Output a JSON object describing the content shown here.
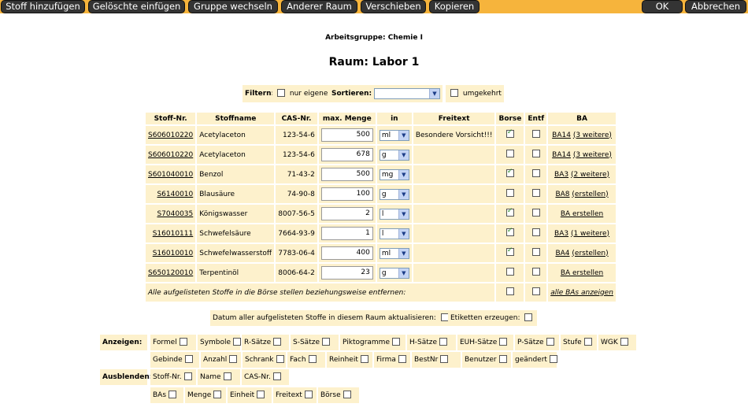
{
  "toolbar": {
    "left_buttons": [
      "Stoff hinzufügen",
      "Gelöschte einfügen",
      "Gruppe wechseln",
      "Anderer Raum",
      "Verschieben",
      "Kopieren"
    ],
    "right_buttons": [
      "OK",
      "Abbrechen"
    ],
    "bar_color": "#f6b43c"
  },
  "header": {
    "arbeitsgruppe": "Arbeitsgruppe: Chemie I",
    "raum": "Raum: Labor 1"
  },
  "filter": {
    "filter_label": "Filtern:",
    "nur_eigene": "nur eigene",
    "sortieren_label": "Sortieren:",
    "sortieren_value": "",
    "umgekehrt": "umgekehrt"
  },
  "table": {
    "columns": [
      "Stoff-Nr.",
      "Stoffname",
      "CAS-Nr.",
      "max. Menge",
      "in",
      "Freitext",
      "Borse",
      "Entf",
      "BA"
    ],
    "rows": [
      {
        "nr": "S606010220",
        "name": "Acetylaceton",
        "cas": "123-54-6",
        "menge": "500",
        "unit": "ml",
        "freitext": "Besondere Vorsicht!!!",
        "borse": true,
        "entf": false,
        "ba": "BA14",
        "ba_more": "(3 weitere)"
      },
      {
        "nr": "S606010220",
        "name": "Acetylaceton",
        "cas": "123-54-6",
        "menge": "678",
        "unit": "g",
        "freitext": "",
        "borse": false,
        "entf": false,
        "ba": "BA14",
        "ba_more": "(3 weitere)"
      },
      {
        "nr": "S601040010",
        "name": "Benzol",
        "cas": "71-43-2",
        "menge": "500",
        "unit": "mg",
        "freitext": "",
        "borse": true,
        "entf": false,
        "ba": "BA3",
        "ba_more": "(2 weitere)"
      },
      {
        "nr": "S6140010",
        "name": "Blausäure",
        "cas": "74-90-8",
        "menge": "100",
        "unit": "g",
        "freitext": "",
        "borse": false,
        "entf": false,
        "ba": "BA8",
        "ba_more": "(erstellen)"
      },
      {
        "nr": "S7040035",
        "name": "Königswasser",
        "cas": "8007-56-5",
        "menge": "2",
        "unit": "l",
        "freitext": "",
        "borse": true,
        "entf": false,
        "ba": "BA erstellen",
        "ba_more": ""
      },
      {
        "nr": "S16010111",
        "name": "Schwefelsäure",
        "cas": "7664-93-9",
        "menge": "1",
        "unit": "l",
        "freitext": "",
        "borse": true,
        "entf": false,
        "ba": "BA3",
        "ba_more": "(1 weitere)"
      },
      {
        "nr": "S16010010",
        "name": "Schwefelwasserstoff",
        "cas": "7783-06-4",
        "menge": "400",
        "unit": "ml",
        "freitext": "",
        "borse": true,
        "entf": false,
        "ba": "BA4",
        "ba_more": "(erstellen)"
      },
      {
        "nr": "S650120010",
        "name": "Terpentinöl",
        "cas": "8006-64-2",
        "menge": "23",
        "unit": "g",
        "freitext": "",
        "borse": false,
        "entf": false,
        "ba": "BA erstellen",
        "ba_more": ""
      }
    ],
    "all_row_text": "Alle aufgelisteten Stoffe in die Börse stellen beziehungsweise entfernen:",
    "all_bas_link": "alle BAs anzeigen"
  },
  "actions": {
    "datum_label": "Datum aller aufgelisteten Stoffe in diesem Raum aktualisieren:",
    "etiketten_label": "Etiketten erzeugen:"
  },
  "anzeigen": {
    "label": "Anzeigen:",
    "row1": [
      "Formel",
      "Symbole",
      "R-Sätze",
      "S-Sätze",
      "Piktogramme",
      "H-Sätze",
      "EUH-Sätze",
      "P-Sätze",
      "Stufe",
      "WGK"
    ],
    "row2": [
      "Gebinde",
      "Anzahl",
      "Schrank",
      "Fach",
      "Reinheit",
      "Firma",
      "BestNr",
      "Benutzer",
      "geändert"
    ]
  },
  "ausblenden": {
    "label": "Ausblenden:",
    "row1": [
      "Stoff-Nr.",
      "Name",
      "CAS-Nr."
    ],
    "row2": [
      "BAs",
      "Menge",
      "Einheit",
      "Freitext",
      "Börse"
    ]
  }
}
